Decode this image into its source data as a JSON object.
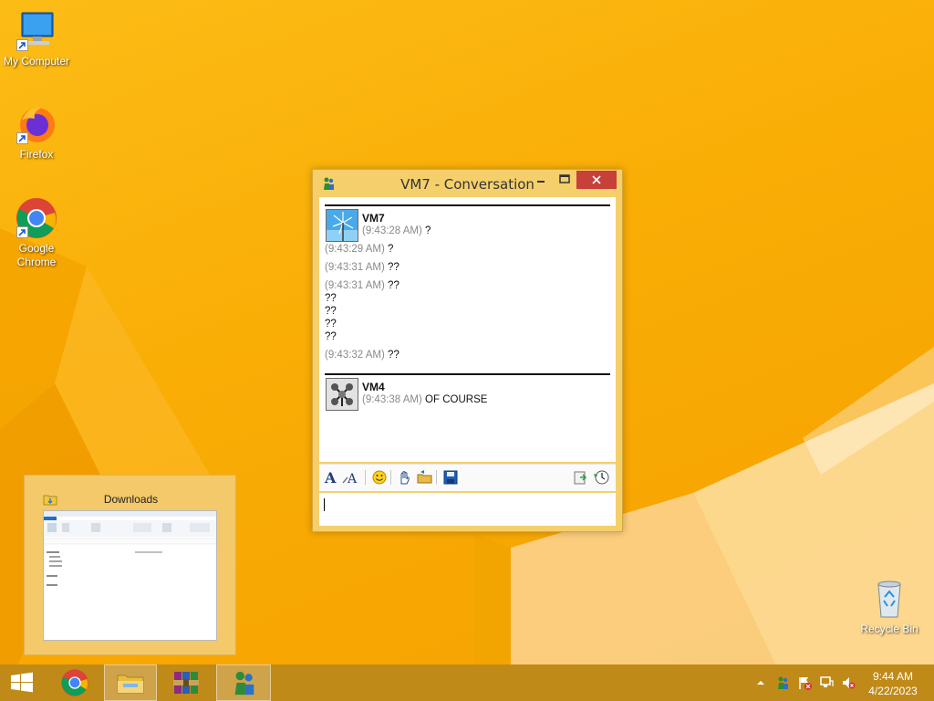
{
  "desktop": {
    "icons": [
      {
        "label": "My Computer",
        "icon": "computer-icon"
      },
      {
        "label": "Firefox",
        "icon": "firefox-icon"
      },
      {
        "label": "Google Chrome",
        "icon": "chrome-icon"
      },
      {
        "label": "Recycle Bin",
        "icon": "recycle-bin-icon"
      }
    ]
  },
  "chat": {
    "title": "VM7 - Conversation",
    "blocks": [
      {
        "sender": "VM7",
        "lines": [
          {
            "time": "(9:43:28 AM)",
            "text": "?"
          },
          {
            "time": "(9:43:29 AM)",
            "text": "?"
          },
          {
            "time": "(9:43:31 AM)",
            "text": "??"
          },
          {
            "time": "(9:43:31 AM)",
            "text": "??"
          },
          {
            "time": "",
            "text": "??"
          },
          {
            "time": "",
            "text": "??"
          },
          {
            "time": "",
            "text": "??"
          },
          {
            "time": "",
            "text": "??"
          },
          {
            "time": "(9:43:32 AM)",
            "text": "??"
          }
        ]
      },
      {
        "sender": "VM4",
        "lines": [
          {
            "time": "(9:43:38 AM)",
            "text": "OF COURSE"
          }
        ]
      }
    ],
    "input_value": ""
  },
  "preview": {
    "title": "Downloads"
  },
  "taskbar": {
    "apps": [
      "start-icon",
      "chrome-icon",
      "file-explorer-icon",
      "winrar-icon",
      "messenger-icon"
    ],
    "clock_time": "9:44 AM",
    "clock_date": "4/22/2023"
  },
  "colors": {
    "desktop": "#f9ad05",
    "taskbar": "#c08a18",
    "window_frame": "#f5cf6b",
    "close_button": "#c7403a"
  }
}
